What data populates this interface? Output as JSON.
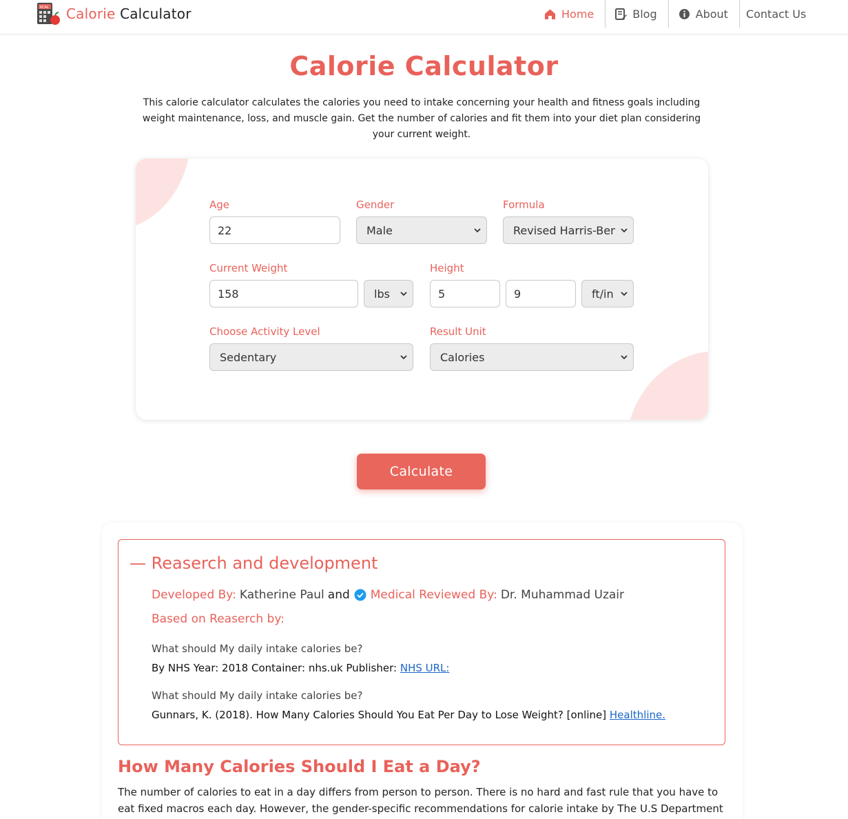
{
  "nav": {
    "brand_part1": "Calorie",
    "brand_part2": "Calculator",
    "logo_icon": "kcal-calculator-apple-icon",
    "items": [
      {
        "label": "Home",
        "icon": "home-icon",
        "active": true
      },
      {
        "label": "Blog",
        "icon": "blog-edit-icon",
        "active": false
      },
      {
        "label": "About",
        "icon": "info-icon",
        "active": false
      },
      {
        "label": "Contact Us",
        "active": false
      }
    ]
  },
  "hero": {
    "title": "Calorie Calculator",
    "intro": "This calorie calculator calculates the calories you need to intake concerning your health and fitness goals including weight maintenance, loss, and muscle gain. Get the number of calories and fit them into your diet plan considering your current weight."
  },
  "form": {
    "age_label": "Age",
    "age_value": "22",
    "gender_label": "Gender",
    "gender_value": "Male",
    "formula_label": "Formula",
    "formula_value": "Revised Harris-Benedict",
    "weight_label": "Current Weight",
    "weight_value": "158",
    "weight_unit": "lbs",
    "height_label": "Height",
    "height_ft": "5",
    "height_in": "9",
    "height_unit": "ft/in",
    "activity_label": "Choose Activity Level",
    "activity_value": "Sedentary",
    "result_unit_label": "Result Unit",
    "result_unit_value": "Calories",
    "calculate_label": "Calculate"
  },
  "research": {
    "title": "— Reaserch and development",
    "developed_by_label": "Developed By:",
    "developer": "Katherine Paul",
    "and": "and",
    "reviewed_by_label": "Medical Reviewed By:",
    "reviewer": "Dr. Muhammad Uzair",
    "based_on_label": "Based on Reaserch by:",
    "refs": [
      {
        "question": "What should My daily intake calories be?",
        "citation": "By NHS Year: 2018 Container: nhs.uk Publisher:",
        "link": "NHS URL:"
      },
      {
        "question": "What should My daily intake calories be?",
        "citation": "Gunnars, K. (2018). How Many Calories Should You Eat Per Day to Lose Weight? [online]",
        "link": "Healthline."
      }
    ]
  },
  "section": {
    "heading": "How Many Calories Should I Eat a Day?",
    "text": "The number of calories to eat in a day differs from person to person. There is no hard and fast rule that you have to eat fixed macros each day. However, the gender-specific recommendations for calorie intake by The U.S Department of"
  },
  "colors": {
    "accent": "#e8625a",
    "blob": "#fde2e2",
    "link": "#1a66c9",
    "verified": "#1d9bf0"
  }
}
